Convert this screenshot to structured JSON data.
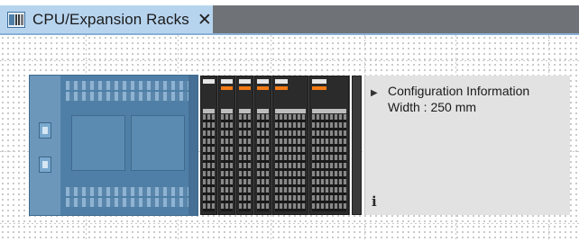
{
  "tab": {
    "title": "CPU/Expansion Racks",
    "close_symbol": "✕",
    "icon": "rack-icon"
  },
  "info_panel": {
    "title": "Configuration Information",
    "width_text": "Width : 250 mm",
    "expand_icon": "expand-arrow-icon",
    "info_icon": "info-icon",
    "info_glyph": "i"
  },
  "rack": {
    "cpu_unit": "cpu-unit",
    "expansion_units": 7
  },
  "colors": {
    "tab_active": "#b7d4ef",
    "tab_inactive_area": "#6f7377",
    "cpu_body": "#4f7fa6",
    "unit_body": "#2b2b2b",
    "unit_accent": "#f27a14",
    "info_bg": "#e2e2e2"
  }
}
